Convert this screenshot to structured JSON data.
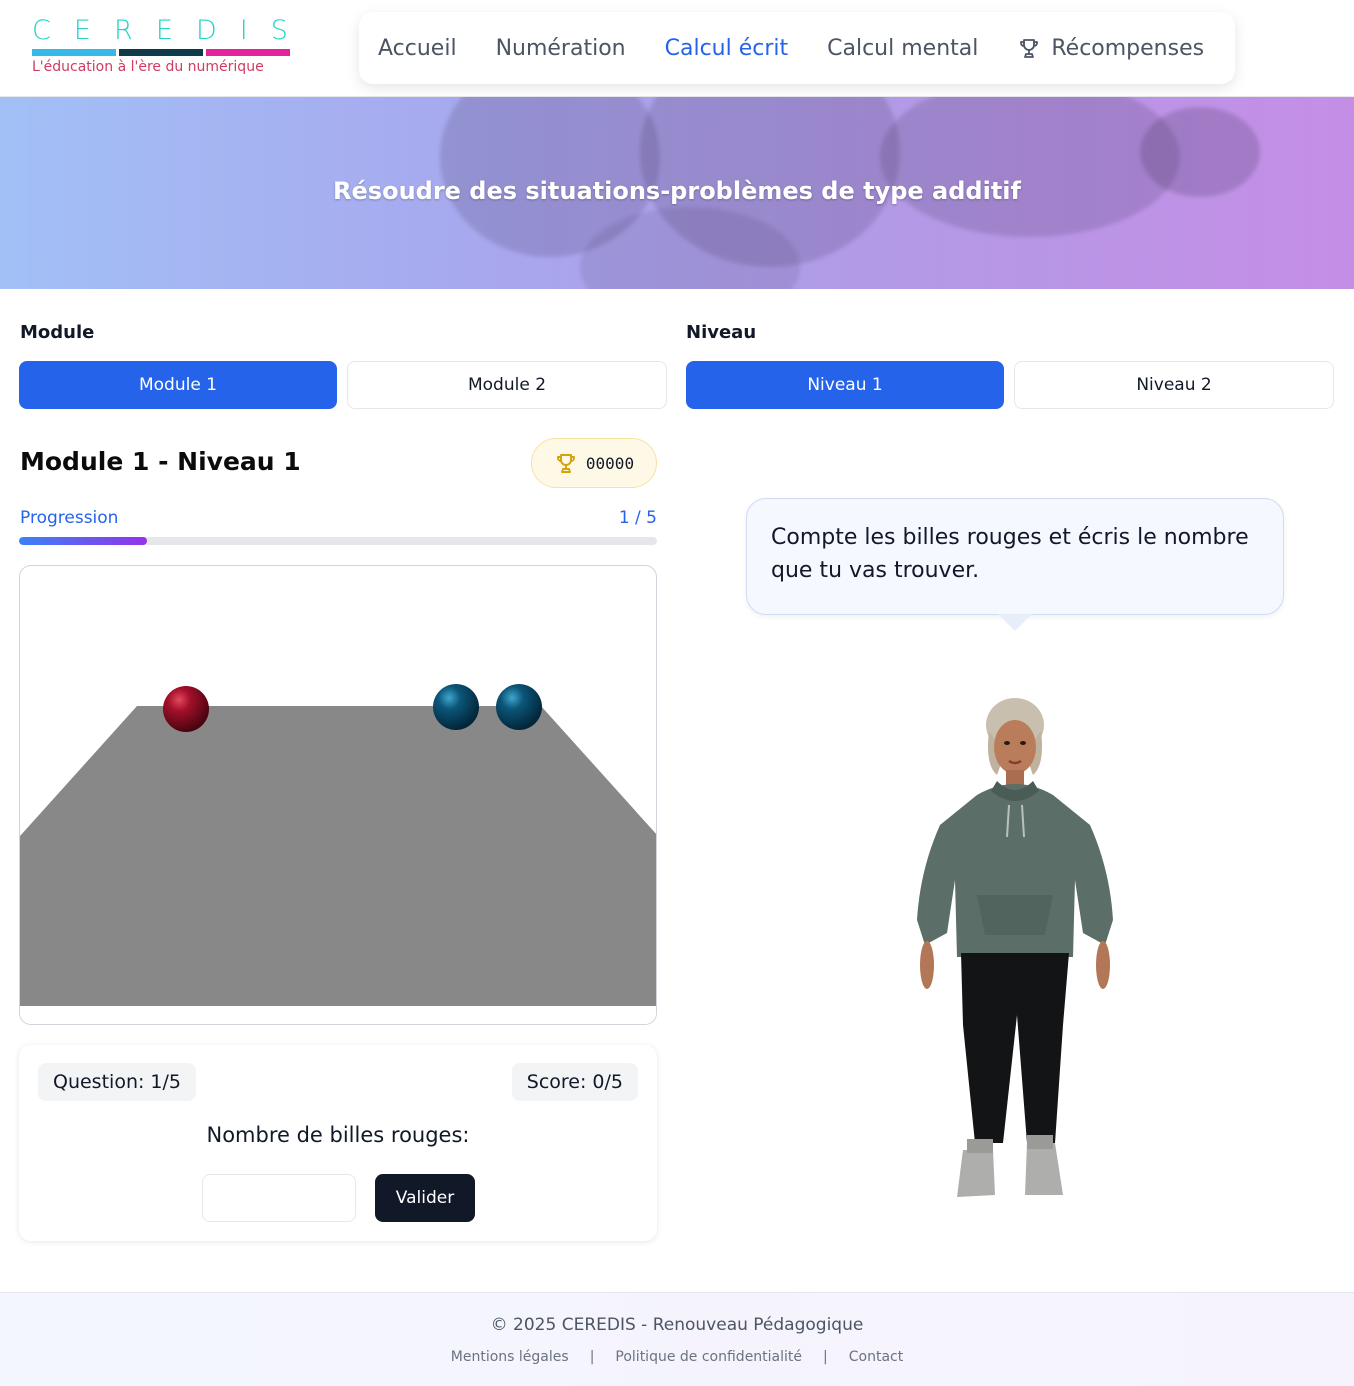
{
  "logo": {
    "letters": [
      "C",
      "E",
      "R",
      "E",
      "D",
      "I",
      "S"
    ],
    "tagline": "L'éducation à l'ère du numérique",
    "bar_colors": [
      "#35b9e6",
      "#0f3a4a",
      "#e2239a"
    ]
  },
  "nav": {
    "items": [
      {
        "label": "Accueil",
        "active": false
      },
      {
        "label": "Numération",
        "active": false
      },
      {
        "label": "Calcul écrit",
        "active": true
      },
      {
        "label": "Calcul mental",
        "active": false
      },
      {
        "label": "Récompenses",
        "active": false,
        "icon": "trophy-icon"
      }
    ]
  },
  "hero": {
    "title": "Résoudre des situations-problèmes de type additif"
  },
  "module": {
    "label": "Module",
    "options": [
      {
        "label": "Module 1",
        "selected": true
      },
      {
        "label": "Module 2",
        "selected": false
      }
    ]
  },
  "level": {
    "label": "Niveau",
    "options": [
      {
        "label": "Niveau 1",
        "selected": true
      },
      {
        "label": "Niveau 2",
        "selected": false
      }
    ]
  },
  "exercise": {
    "title": "Module 1 - Niveau 1",
    "points": "00000",
    "points_icon": "trophy-icon",
    "progress_label": "Progression",
    "progress_count": "1 / 5",
    "progress_fraction": 0.2
  },
  "scene": {
    "marbles": [
      {
        "color": "red"
      },
      {
        "color": "blue"
      },
      {
        "color": "blue"
      }
    ],
    "colors": {
      "table": "#888888",
      "red": "#8b0c1c",
      "blue": "#0b4f6c"
    }
  },
  "quiz": {
    "question_chip": "Question: 1/5",
    "score_chip": "Score: 0/5",
    "prompt": "Nombre de billes rouges:",
    "answer_value": "",
    "answer_placeholder": "",
    "submit_label": "Valider"
  },
  "assistant": {
    "message": "Compte les billes rouges et écris le nombre que tu vas trouver."
  },
  "footer": {
    "copyright": "© 2025 CEREDIS - Renouveau Pédagogique",
    "links": [
      "Mentions légales",
      "Politique de confidentialité",
      "Contact"
    ],
    "separator": "|"
  },
  "theme": {
    "primary": "#2563eb",
    "dark": "#111827",
    "logo_teal": "#22d3c5",
    "logo_red": "#d23a62"
  }
}
